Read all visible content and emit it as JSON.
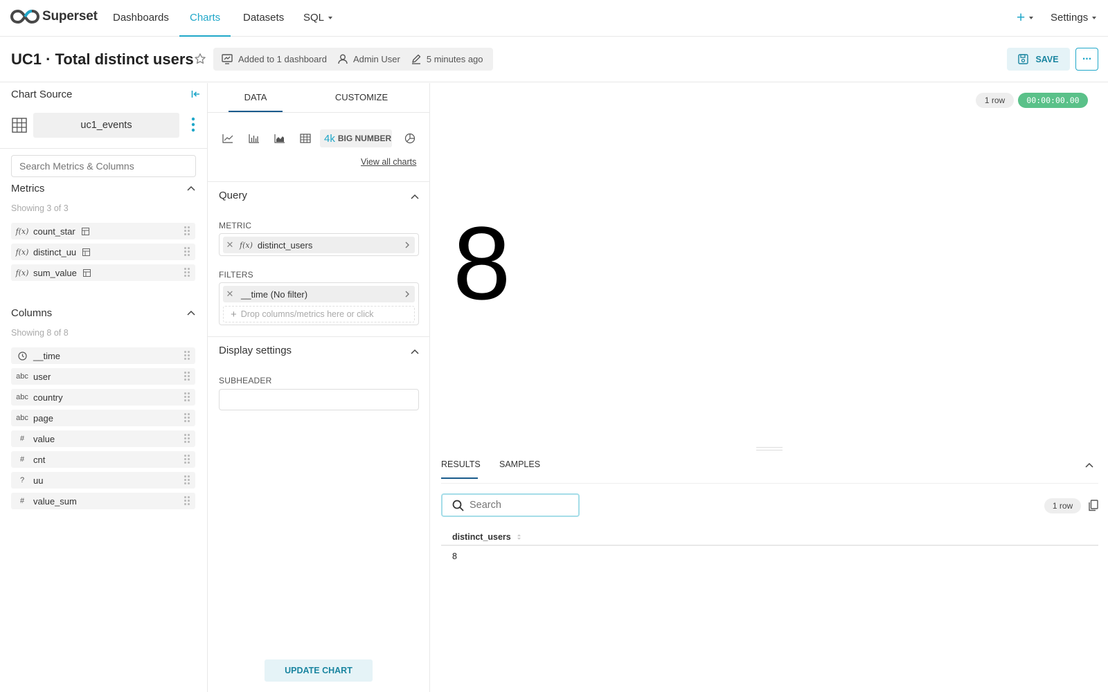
{
  "nav": {
    "brand": "Superset",
    "items": [
      "Dashboards",
      "Charts",
      "Datasets",
      "SQL"
    ],
    "active": "Charts",
    "plus": "+",
    "settings": "Settings"
  },
  "header": {
    "title": "UC1 · Total distinct users",
    "added": "Added to 1 dashboard",
    "owner": "Admin User",
    "modified": "5 minutes ago",
    "save": "SAVE",
    "more": "..."
  },
  "source": {
    "title": "Chart Source",
    "dataset": "uc1_events",
    "search_placeholder": "Search Metrics & Columns",
    "metrics_title": "Metrics",
    "metrics_showing": "Showing 3 of 3",
    "metrics": [
      {
        "icon": "f(x)",
        "name": "count_star"
      },
      {
        "icon": "f(x)",
        "name": "distinct_uu"
      },
      {
        "icon": "f(x)",
        "name": "sum_value"
      }
    ],
    "columns_title": "Columns",
    "columns_showing": "Showing 8 of 8",
    "columns": [
      {
        "icon": "clock",
        "name": "__time"
      },
      {
        "icon": "abc",
        "name": "user"
      },
      {
        "icon": "abc",
        "name": "country"
      },
      {
        "icon": "abc",
        "name": "page"
      },
      {
        "icon": "#",
        "name": "value"
      },
      {
        "icon": "#",
        "name": "cnt"
      },
      {
        "icon": "?",
        "name": "uu"
      },
      {
        "icon": "#",
        "name": "value_sum"
      }
    ]
  },
  "controls": {
    "tabs": [
      "DATA",
      "CUSTOMIZE"
    ],
    "viz_icon": "4k",
    "viz_label": "BIG NUMBER",
    "view_all": "View all charts",
    "query_title": "Query",
    "metric_label": "METRIC",
    "metric_icon": "f(x)",
    "metric_value": "distinct_users",
    "filters_label": "FILTERS",
    "filter_value": "__time (No filter)",
    "filter_placeholder": "Drop columns/metrics here or click",
    "display_title": "Display settings",
    "subheader_label": "SUBHEADER",
    "subheader_value": "",
    "update": "UPDATE CHART"
  },
  "chart": {
    "row_badge": "1 row",
    "timer": "00:00:00.00",
    "big_number": "8"
  },
  "results": {
    "tabs": [
      "RESULTS",
      "SAMPLES"
    ],
    "search_placeholder": "Search",
    "row_badge": "1 row",
    "column": "distinct_users",
    "rows": [
      "8"
    ]
  },
  "colors": {
    "accent": "#20a7c9",
    "timer_green": "#5ac189"
  }
}
